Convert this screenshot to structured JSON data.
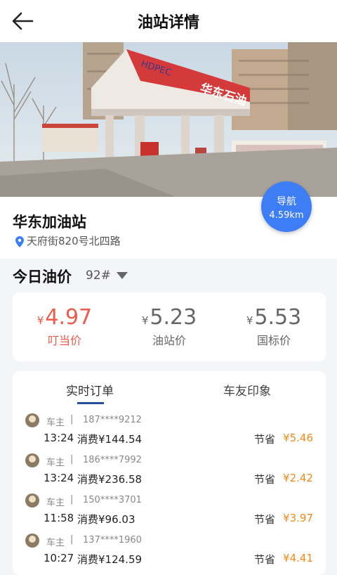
{
  "header": {
    "title": "油站详情"
  },
  "hero_sign": {
    "brand": "HDPEC",
    "name": "华东石油"
  },
  "nav": {
    "label": "导航",
    "distance": "4.59km"
  },
  "station": {
    "name": "华东加油站",
    "address": "天府街820号北四路"
  },
  "prices": {
    "heading": "今日油价",
    "grade": "92#",
    "currency": "¥",
    "items": [
      {
        "value": "4.97",
        "label": "叮当价"
      },
      {
        "value": "5.23",
        "label": "油站价"
      },
      {
        "value": "5.53",
        "label": "国标价"
      }
    ]
  },
  "tabs": [
    {
      "label": "实时订单"
    },
    {
      "label": "车友印象"
    }
  ],
  "orders": [
    {
      "owner": "车主",
      "sep": "|",
      "phone": "187****9212",
      "time": "13:24",
      "spend": "消费¥144.54",
      "save_label": "节省",
      "save": "¥5.46"
    },
    {
      "owner": "车主",
      "sep": "|",
      "phone": "186****7992",
      "time": "13:24",
      "spend": "消费¥236.58",
      "save_label": "节省",
      "save": "¥2.42"
    },
    {
      "owner": "车主",
      "sep": "|",
      "phone": "150****3701",
      "time": "11:58",
      "spend": "消费¥96.03",
      "save_label": "节省",
      "save": "¥3.97"
    },
    {
      "owner": "车主",
      "sep": "|",
      "phone": "137****1960",
      "time": "10:27",
      "spend": "消费¥124.59",
      "save_label": "节省",
      "save": "¥4.41"
    }
  ],
  "colors": {
    "accent": "#3d7df5",
    "discount": "#ee5b4b",
    "saving": "#f08a19"
  }
}
